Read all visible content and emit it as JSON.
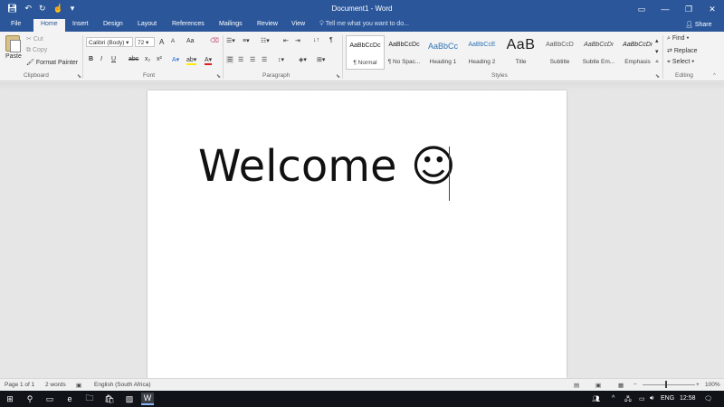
{
  "titlebar": {
    "title": "Document1 - Word",
    "qat": {
      "save_icon": "save-icon",
      "undo_icon": "undo-icon",
      "redo_icon": "redo-icon",
      "touch_icon": "touch-mode-icon",
      "customize_icon": "customize-icon"
    },
    "window_buttons": {
      "options": "▭",
      "minimize": "—",
      "maximize": "❐",
      "close": "✕"
    }
  },
  "tabs": {
    "file": "File",
    "home": "Home",
    "insert": "Insert",
    "design": "Design",
    "layout": "Layout",
    "references": "References",
    "mailings": "Mailings",
    "review": "Review",
    "view": "View",
    "tellme": "Tell me what you want to do...",
    "share": "Share"
  },
  "ribbon": {
    "clipboard": {
      "paste": "Paste",
      "cut": "Cut",
      "copy": "Copy",
      "format_painter": "Format Painter",
      "label": "Clipboard"
    },
    "font": {
      "name": "Calibri (Body)",
      "size": "72",
      "grow": "A",
      "shrink": "A",
      "case": "Aa",
      "bold": "B",
      "italic": "I",
      "underline": "U",
      "strike": "abc",
      "subscript": "x₂",
      "superscript": "x²",
      "label": "Font"
    },
    "paragraph": {
      "label": "Paragraph",
      "show_marks": "¶"
    },
    "styles": {
      "label": "Styles",
      "items": [
        {
          "sample": "AaBbCcDc",
          "name": "¶ Normal"
        },
        {
          "sample": "AaBbCcDc",
          "name": "¶ No Spac..."
        },
        {
          "sample": "AaBbCc",
          "name": "Heading 1"
        },
        {
          "sample": "AaBbCcE",
          "name": "Heading 2"
        },
        {
          "sample": "AaB",
          "name": "Title"
        },
        {
          "sample": "AaBbCcD",
          "name": "Subtitle"
        },
        {
          "sample": "AaBbCcDı",
          "name": "Subtle Em..."
        },
        {
          "sample": "AaBbCcDı",
          "name": "Emphasis"
        }
      ]
    },
    "editing": {
      "find": "Find",
      "replace": "Replace",
      "select": "Select",
      "label": "Editing"
    }
  },
  "document": {
    "text": "Welcome ☺"
  },
  "status": {
    "page": "Page 1 of 1",
    "words": "2 words",
    "language": "English (South Africa)",
    "zoom": "100%"
  },
  "taskbar": {
    "lang": "ENG",
    "time": "12:58"
  },
  "colors": {
    "brand": "#2b579a",
    "ribbon": "#f3f3f3",
    "canvas": "#e6e6e6"
  }
}
